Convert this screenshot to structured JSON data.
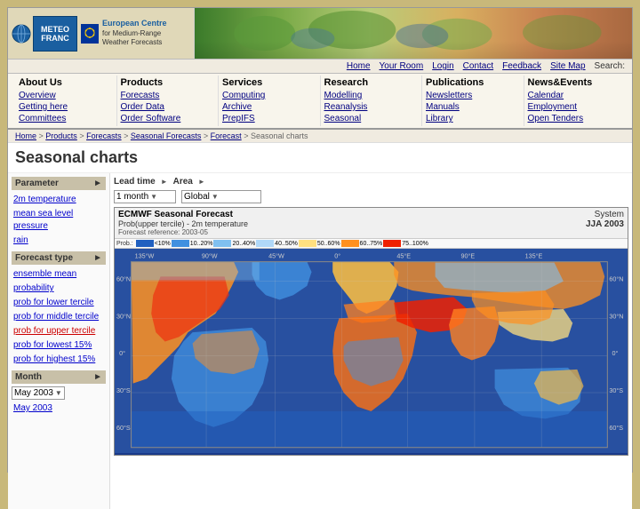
{
  "site": {
    "meteo_logo_line1": "METEO",
    "meteo_logo_line2": "FRANC",
    "ecmwf_title": "European Centre",
    "ecmwf_subtitle1": "for Medium-Range",
    "ecmwf_subtitle2": "Weather Forecasts"
  },
  "nav": {
    "links": [
      "Home",
      "Your Room",
      "Login",
      "Contact",
      "Feedback",
      "Site Map"
    ],
    "search_label": "Search:"
  },
  "menu": {
    "sections": [
      {
        "heading": "About Us",
        "items": [
          "Overview",
          "Getting here",
          "Committees"
        ]
      },
      {
        "heading": "Products",
        "items": [
          "Forecasts",
          "Order Data",
          "Order Software"
        ]
      },
      {
        "heading": "Services",
        "items": [
          "Computing",
          "Archive",
          "PrepIFS"
        ]
      },
      {
        "heading": "Research",
        "items": [
          "Modelling",
          "Reanalysis",
          "Seasonal"
        ]
      },
      {
        "heading": "Publications",
        "items": [
          "Newsletters",
          "Manuals",
          "Library"
        ]
      },
      {
        "heading": "News&Events",
        "items": [
          "Calendar",
          "Employment",
          "Open Tenders"
        ]
      }
    ]
  },
  "breadcrumb": {
    "items": [
      "Home",
      "Products",
      "Forecasts",
      "Seasonal Forecasts",
      "Forecast",
      "Seasonal charts"
    ]
  },
  "page": {
    "title": "Seasonal charts"
  },
  "controls": {
    "parameter_label": "Parameter",
    "leadtime_label": "Lead time",
    "area_label": "Area",
    "month_value": "1 month",
    "area_value": "Global"
  },
  "parameters": [
    {
      "label": "2m temperature",
      "active": true
    },
    {
      "label": "mean sea level pressure",
      "active": false
    },
    {
      "label": "rain",
      "active": false
    }
  ],
  "forecast_types": {
    "section_label": "Forecast type",
    "items": [
      {
        "label": "ensemble mean",
        "active": true
      },
      {
        "label": "probability",
        "active": false
      },
      {
        "label": "prob for lower tercile",
        "active": false
      },
      {
        "label": "prob for middle tercile",
        "active": false
      },
      {
        "label": "prob for upper tercile",
        "active": true,
        "blue": true
      },
      {
        "label": "prob for lowest 15%",
        "active": false
      },
      {
        "label": "prob for highest 15%",
        "active": false
      }
    ]
  },
  "month_section": {
    "label": "Month",
    "dropdown_value": "May 2003",
    "sub_label": "May 2003"
  },
  "map": {
    "title_main": "ECMWF Seasonal Forecast",
    "subtitle": "Prob(upper tercile) - 2m temperature",
    "forecast_line": "Forecast reference: 2003-05",
    "system": "System",
    "system_year": "JJA 2003",
    "legend_items": [
      {
        "label": "< 10%",
        "color": "#2060c0"
      },
      {
        "label": "10-20%",
        "color": "#4090e0"
      },
      {
        "label": "20-40%",
        "color": "#80c0f0"
      },
      {
        "label": "40-50%",
        "color": "#c0e0f8"
      },
      {
        "label": "50-60%",
        "color": "#fff8c0"
      },
      {
        "label": "60-75%",
        "color": "#ffc040"
      },
      {
        "label": "75-100%",
        "color": "#ff4020"
      }
    ],
    "x_labels": [
      "135°W",
      "90°W",
      "45°W",
      "0°",
      "45°E",
      "90°E",
      "135°E"
    ],
    "y_labels_left": [
      "60°N",
      "30°N",
      "0°",
      "30°S",
      "60°S"
    ],
    "y_labels_right": [
      "60°N",
      "30°N",
      "0°",
      "30°S",
      "60°S"
    ]
  }
}
